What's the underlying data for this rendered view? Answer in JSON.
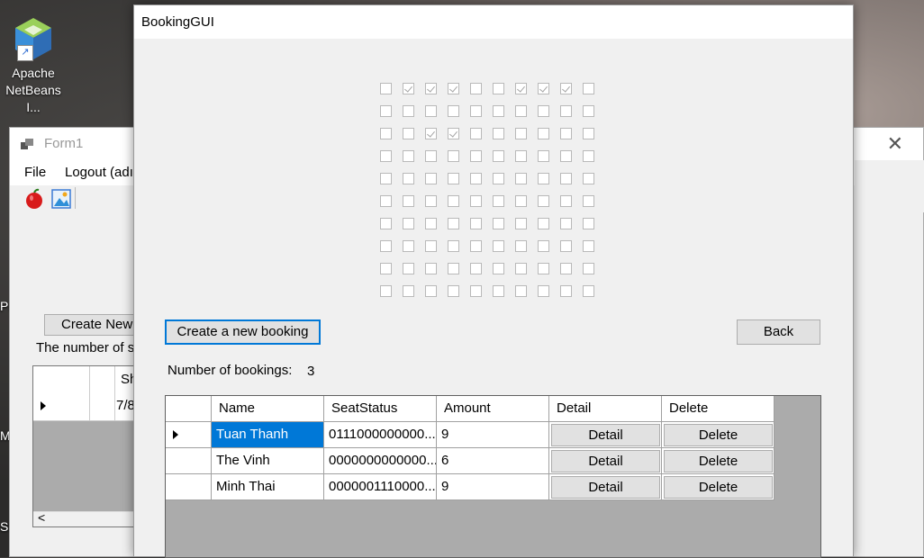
{
  "desktop": {
    "icon_label_line1": "Apache",
    "icon_label_line2": "NetBeans I...",
    "side_text_1": "PI",
    "side_text_2": "Mi",
    "side_text_3": "Mi",
    "side_text_4": "SE"
  },
  "form1": {
    "title": "Form1",
    "close_glyph": "✕",
    "menu": {
      "file": "File",
      "logout": "Logout (adı"
    },
    "create_button": "Create New",
    "number_text": "The number of s",
    "grid": {
      "header_col": "Sh",
      "row_value": "7/8",
      "scroll_left": "<"
    }
  },
  "booking": {
    "title": "BookingGUI",
    "seats": [
      [
        0,
        1,
        1,
        1,
        0,
        0,
        1,
        1,
        1,
        0
      ],
      [
        0,
        0,
        0,
        0,
        0,
        0,
        0,
        0,
        0,
        0
      ],
      [
        0,
        0,
        1,
        1,
        0,
        0,
        0,
        0,
        0,
        0
      ],
      [
        0,
        0,
        0,
        0,
        0,
        0,
        0,
        0,
        0,
        0
      ],
      [
        0,
        0,
        0,
        0,
        0,
        0,
        0,
        0,
        0,
        0
      ],
      [
        0,
        0,
        0,
        0,
        0,
        0,
        0,
        0,
        0,
        0
      ],
      [
        0,
        0,
        0,
        0,
        0,
        0,
        0,
        0,
        0,
        0
      ],
      [
        0,
        0,
        0,
        0,
        0,
        0,
        0,
        0,
        0,
        0
      ],
      [
        0,
        0,
        0,
        0,
        0,
        0,
        0,
        0,
        0,
        0
      ],
      [
        0,
        0,
        0,
        0,
        0,
        0,
        0,
        0,
        0,
        0
      ]
    ],
    "create_button": "Create a new booking",
    "back_button": "Back",
    "num_label": "Number of bookings:",
    "num_value": "3",
    "grid": {
      "columns": [
        "Name",
        "SeatStatus",
        "Amount",
        "Detail",
        "Delete"
      ],
      "rows": [
        {
          "name": "Tuan Thanh",
          "seat": "0111000000000...",
          "amount": "9",
          "detail": "Detail",
          "delete": "Delete"
        },
        {
          "name": "The Vinh",
          "seat": "0000000000000...",
          "amount": "6",
          "detail": "Detail",
          "delete": "Delete"
        },
        {
          "name": "Minh Thai",
          "seat": "0000001110000...",
          "amount": "9",
          "detail": "Detail",
          "delete": "Delete"
        }
      ]
    }
  },
  "colors": {
    "accent": "#0078d7",
    "grid_bg": "#ababab",
    "window_bg": "#f0f0f0"
  }
}
